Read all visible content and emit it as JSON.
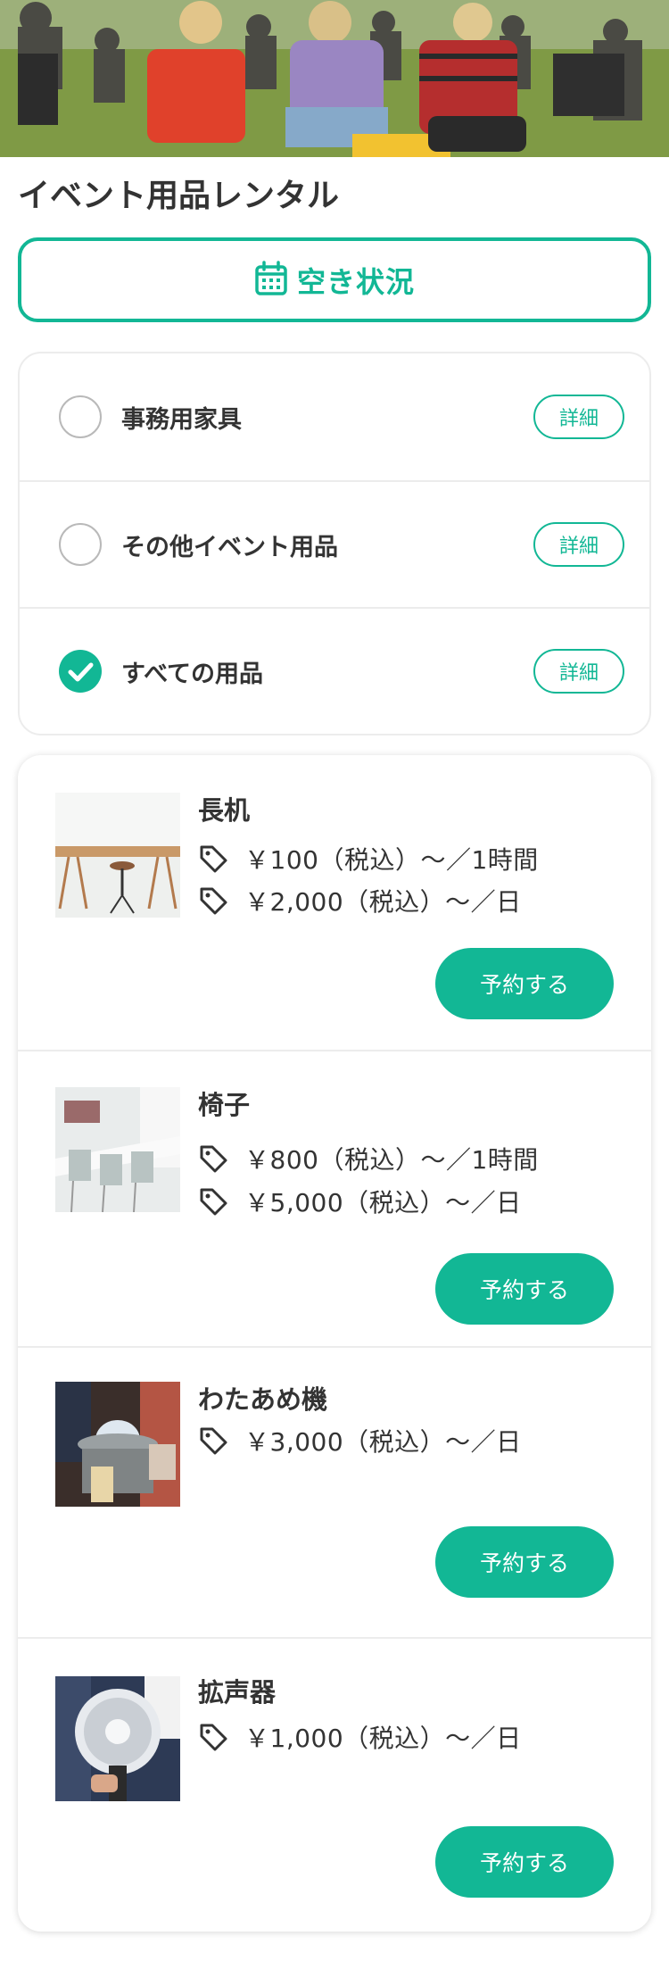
{
  "hero": {
    "icon": "crowd-photo"
  },
  "page": {
    "title": "イベント用品レンタル"
  },
  "availability": {
    "label": "空き状況",
    "icon": "calendar-icon",
    "color": "#12b795"
  },
  "categories": [
    {
      "label": "事務用家具",
      "checked": false,
      "detail_label": "詳細"
    },
    {
      "label": "その他イベント用品",
      "checked": false,
      "detail_label": "詳細"
    },
    {
      "label": "すべての用品",
      "checked": true,
      "detail_label": "詳細"
    }
  ],
  "products": [
    {
      "name": "長机",
      "prices": [
        "￥100（税込）〜／1時間",
        "￥2,000（税込）〜／日"
      ],
      "button": "予約する"
    },
    {
      "name": "椅子",
      "prices": [
        "￥800（税込）〜／1時間",
        "￥5,000（税込）〜／日"
      ],
      "button": "予約する"
    },
    {
      "name": "わたあめ機",
      "prices": [
        "￥3,000（税込）〜／日"
      ],
      "button": "予約する"
    },
    {
      "name": "拡声器",
      "prices": [
        "￥1,000（税込）〜／日"
      ],
      "button": "予約する"
    }
  ],
  "colors": {
    "accent": "#12b795",
    "text": "#333333",
    "divider": "#ececec"
  }
}
